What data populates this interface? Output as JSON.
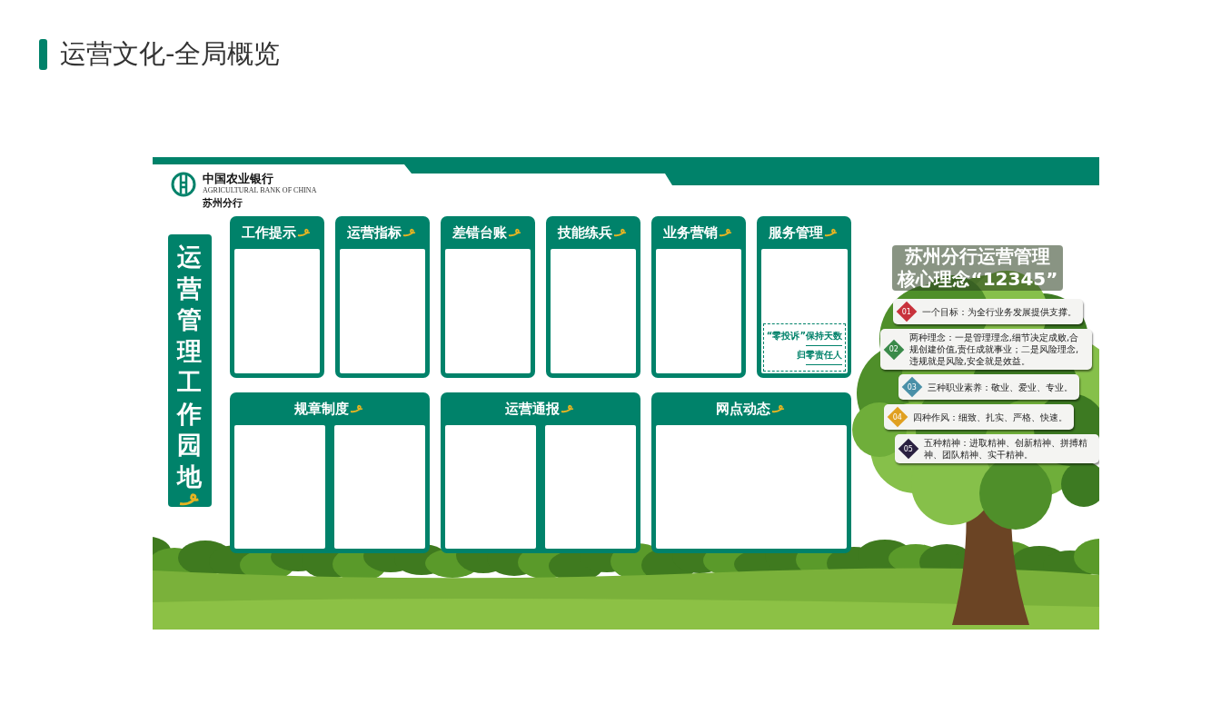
{
  "page": {
    "title": "运营文化-全局概览"
  },
  "board": {
    "bank_name": "中国农业银行",
    "bank_name_en": "AGRICULTURAL BANK OF CHINA",
    "branch": "苏州分行",
    "vertical_title": "运营管理工作园地",
    "top_panels": [
      {
        "title": "工作提示"
      },
      {
        "title": "运营指标"
      },
      {
        "title": "差错台账"
      },
      {
        "title": "技能练兵"
      },
      {
        "title": "业务营销"
      },
      {
        "title": "服务管理",
        "fields": [
          "“零投诉”保持天数",
          "归零责任人"
        ]
      }
    ],
    "bottom_panels": [
      {
        "title": "规章制度",
        "kind": "split"
      },
      {
        "title": "运营通报",
        "kind": "split"
      },
      {
        "title": "网点动态",
        "kind": "single"
      }
    ],
    "tree": {
      "title_lines": [
        "苏州分行运营管理",
        "核心理念“12345”"
      ],
      "items": [
        {
          "number": "01",
          "text": "一个目标：为全行业务发展提供支撑。",
          "color": "#c8323c"
        },
        {
          "number": "02",
          "text": "两种理念：一是管理理念,细节决定成败,合规创建价值,责任成就事业；二是风险理念,违规就是风险,安全就是效益。",
          "color": "#3a8a4a"
        },
        {
          "number": "03",
          "text": "三种职业素养：敬业、爱业、专业。",
          "color": "#4a90a8"
        },
        {
          "number": "04",
          "text": "四种作风：细致、扎实、严格、快速。",
          "color": "#e0a020"
        },
        {
          "number": "05",
          "text": "五种精神：进取精神、创新精神、拼搏精神、团队精神、实干精神。",
          "color": "#2a2040"
        }
      ]
    }
  }
}
